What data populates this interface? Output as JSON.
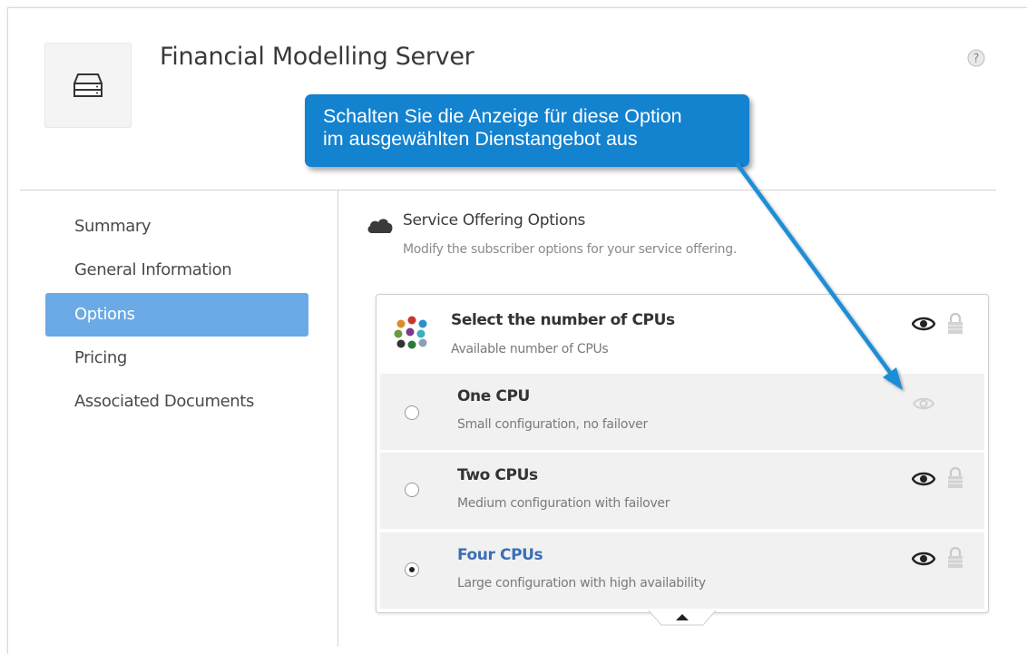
{
  "header": {
    "title": "Financial Modelling Server",
    "server_icon": "server-icon",
    "help_icon": "help-icon"
  },
  "callout": {
    "line1": "Schalten Sie die Anzeige für diese Option",
    "line2": "im ausgewählten Dienstangebot aus"
  },
  "sidebar": {
    "items": [
      {
        "label": "Summary",
        "active": false
      },
      {
        "label": "General Information",
        "active": false
      },
      {
        "label": "Options",
        "active": true
      },
      {
        "label": "Pricing",
        "active": false
      },
      {
        "label": "Associated Documents",
        "active": false
      }
    ]
  },
  "section": {
    "icon": "cloud-icon",
    "title": "Service Offering Options",
    "subtitle": "Modify the subscriber options for your service offering."
  },
  "option_group": {
    "title": "Select the number of CPUs",
    "description": "Available number of CPUs",
    "icon": "cpu-dots-icon",
    "options": [
      {
        "title": "One CPU",
        "description": "Small configuration, no failover",
        "selected": false,
        "visible": false
      },
      {
        "title": "Two CPUs",
        "description": "Medium configuration with failover",
        "selected": false,
        "visible": true
      },
      {
        "title": "Four CPUs",
        "description": "Large configuration with high availability",
        "selected": true,
        "visible": true
      }
    ]
  },
  "colors": {
    "accent_nav": "#6aaae6",
    "callout": "#1382cf",
    "selected_option": "#3a6eb5"
  }
}
